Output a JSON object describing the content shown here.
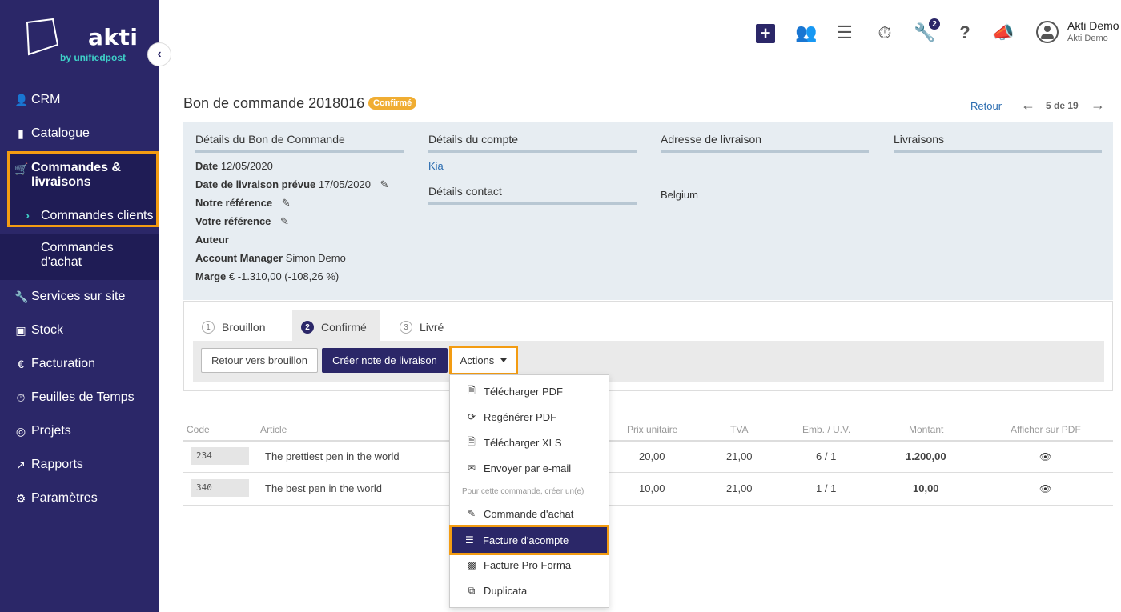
{
  "brand": {
    "name": "akti",
    "tagline": "by unifiedpost"
  },
  "sidebar": {
    "items": [
      {
        "label": "CRM",
        "icon": "user-icon"
      },
      {
        "label": "Catalogue",
        "icon": "book-icon"
      },
      {
        "label": "Commandes & livraisons",
        "icon": "cart-icon"
      },
      {
        "label": "Commandes clients",
        "icon": "chevron-right-icon"
      },
      {
        "label": "Commandes d'achat",
        "icon": ""
      },
      {
        "label": "Services sur site",
        "icon": "wrench-icon"
      },
      {
        "label": "Stock",
        "icon": "cubes-icon"
      },
      {
        "label": "Facturation",
        "icon": "euro-icon"
      },
      {
        "label": "Feuilles de Temps",
        "icon": "stopwatch-icon"
      },
      {
        "label": "Projets",
        "icon": "target-icon"
      },
      {
        "label": "Rapports",
        "icon": "chart-icon"
      },
      {
        "label": "Paramètres",
        "icon": "gear-icon"
      }
    ]
  },
  "topbar": {
    "badge_count": "2",
    "user_name": "Akti Demo",
    "user_company": "Akti Demo"
  },
  "page": {
    "title": "Bon de commande 2018016",
    "status": "Confirmé",
    "back_link": "Retour",
    "pager": "5 de 19"
  },
  "details": {
    "order_header": "Détails du Bon de Commande",
    "account_header": "Détails du compte",
    "address_header": "Adresse de livraison",
    "deliveries_header": "Livraisons",
    "date_label": "Date",
    "date_value": "12/05/2020",
    "delivery_date_label": "Date de livraison prévue",
    "delivery_date_value": "17/05/2020",
    "our_ref_label": "Notre référence",
    "your_ref_label": "Votre référence",
    "author_label": "Auteur",
    "account_manager_label": "Account Manager",
    "account_manager_value": "Simon Demo",
    "margin_label": "Marge",
    "margin_value": "€ -1.310,00 (-108,26 %)",
    "account_name": "Kia",
    "contact_header": "Détails contact",
    "country": "Belgium"
  },
  "tabs": [
    {
      "num": "1",
      "label": "Brouillon"
    },
    {
      "num": "2",
      "label": "Confirmé"
    },
    {
      "num": "3",
      "label": "Livré"
    }
  ],
  "buttons": {
    "back_to_draft": "Retour vers brouillon",
    "create_delivery": "Créer note de livraison",
    "actions": "Actions"
  },
  "table": {
    "headers": [
      "Code",
      "Article",
      "Prix unitaire",
      "TVA",
      "Emb. / U.V.",
      "Montant",
      "Afficher sur PDF"
    ],
    "rows": [
      {
        "code": "234",
        "article": "The prettiest pen in the world",
        "price": "20,00",
        "vat": "21,00",
        "pack": "6 / 1",
        "amount": "1.200,00"
      },
      {
        "code": "340",
        "article": "The best pen in the world",
        "price": "10,00",
        "vat": "21,00",
        "pack": "1 / 1",
        "amount": "10,00"
      }
    ]
  },
  "dropdown": {
    "items": [
      "Télécharger PDF",
      "Regénérer PDF",
      "Télécharger XLS",
      "Envoyer par e-mail"
    ],
    "section_header": "Pour cette commande, créer un(e)",
    "create_items": [
      "Commande d'achat",
      "Facture d'acompte",
      "Facture Pro Forma",
      "Duplicata"
    ]
  },
  "colors": {
    "sidebar": "#2b2768",
    "accent": "#f39c12",
    "status": "#f0ad32",
    "teal": "#3ed0c8"
  }
}
